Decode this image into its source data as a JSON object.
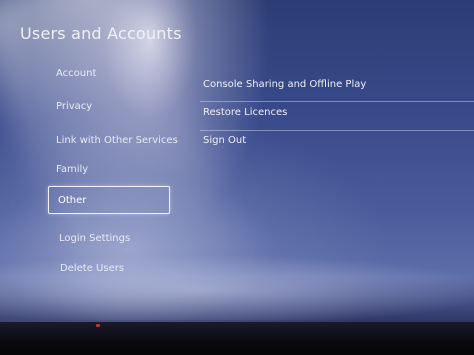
{
  "header": {
    "title": "Users and Accounts"
  },
  "sidebar": {
    "items": [
      {
        "label": "Account"
      },
      {
        "label": "Privacy"
      },
      {
        "label": "Link with Other Services"
      },
      {
        "label": "Family"
      },
      {
        "label": "Other"
      },
      {
        "label": "Login Settings"
      },
      {
        "label": "Delete Users"
      }
    ],
    "selected": "Other"
  },
  "main": {
    "options": [
      {
        "label": "Console Sharing and Offline Play"
      },
      {
        "label": "Restore Licences"
      },
      {
        "label": "Sign Out"
      }
    ]
  }
}
